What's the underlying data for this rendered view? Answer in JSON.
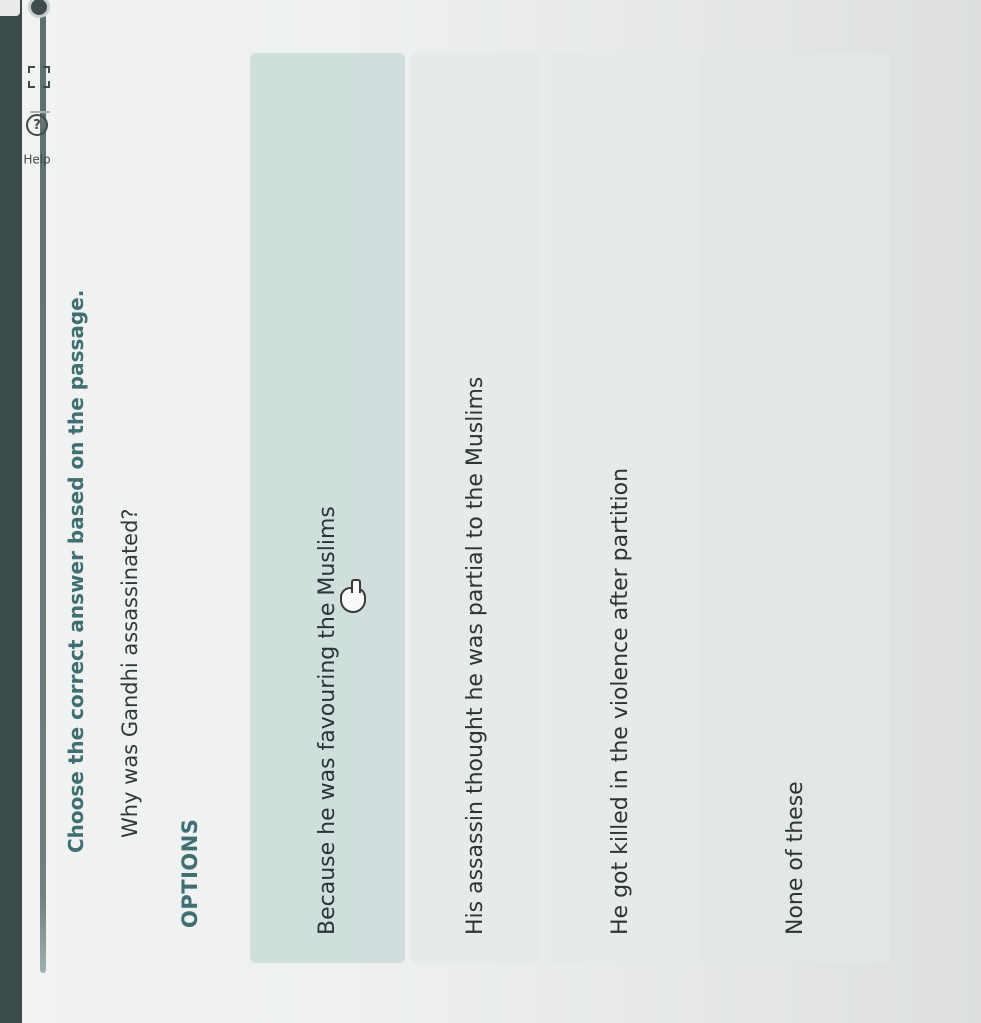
{
  "toolbar": {
    "help_label": "Help",
    "help_icon_glyph": "?"
  },
  "question": {
    "instruction": "Choose the correct answer based on the passage.",
    "text": "Why was Gandhi assassinated?",
    "options_heading": "OPTIONS"
  },
  "options": [
    {
      "label": "Because he was favouring the Muslims"
    },
    {
      "label": "His assassin thought he was partial to the Muslims"
    },
    {
      "label": "He got killed in the violence after partition"
    },
    {
      "label": "None of these"
    }
  ],
  "colors": {
    "accent": "#3e6f72",
    "selected_option_bg": "#c4d8d6"
  }
}
